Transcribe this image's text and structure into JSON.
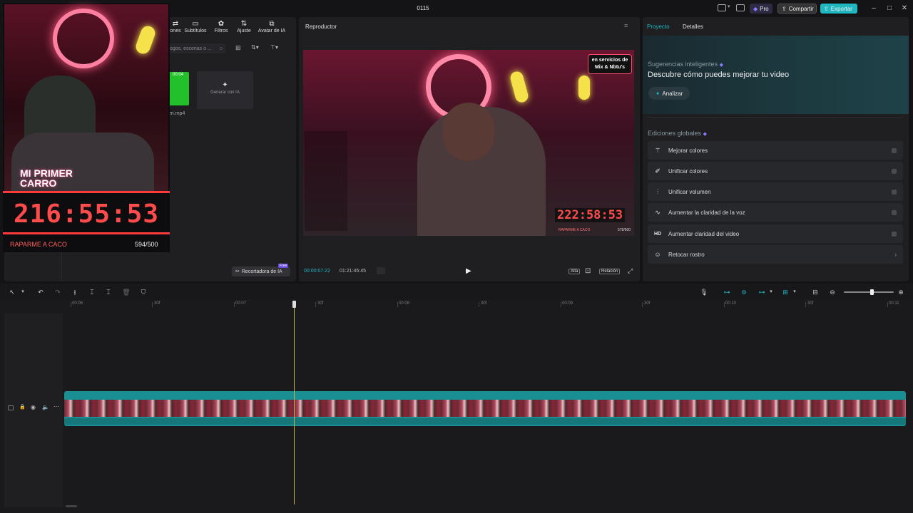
{
  "titlebar": {
    "title": "0115",
    "pro_label": "Pro",
    "share_label": "Compartir",
    "export_label": "Exportar"
  },
  "overlay": {
    "neon_sign_text": "MI PRIMER CARRO",
    "timer": "216:55:53",
    "goal_label": "RAPARME A CACO",
    "goal_count": "594/500"
  },
  "media_panel": {
    "tabs": [
      {
        "label": "ones",
        "icon": "transitions-icon"
      },
      {
        "label": "Subtítulos",
        "icon": "subtitles-icon"
      },
      {
        "label": "Filtros",
        "icon": "filters-icon"
      },
      {
        "label": "Ajuste",
        "icon": "adjust-icon"
      },
      {
        "label": "Avatar de IA",
        "icon": "ai-avatar-icon"
      }
    ],
    "search_placeholder": "ogos, escenas o ...",
    "clip_duration": "00:04",
    "clip_name": "en.mp4",
    "generate_label": "Generar con IA",
    "ai_cutter_label": "Recortadora de IA",
    "free_badge": "Free"
  },
  "player": {
    "title": "Reproductor",
    "current_time": "00:00:07:22",
    "total_time": "01:21:45:45",
    "quality_label": "Alta",
    "ratio_label": "Relación",
    "video": {
      "promo_line1": "en servicios de",
      "promo_line2": "Mix & Nbtu's",
      "timer": "222:58:53",
      "goal_label": "RAPARME A CACO",
      "goal_count": "578/500"
    }
  },
  "right_panel": {
    "tabs": [
      "Proyecto",
      "Detalles"
    ],
    "suggestions_label": "Sugerencias inteligentes",
    "suggestions_headline": "Descubre cómo puedes mejorar tu video",
    "analyze_label": "Analizar",
    "global_edits_label": "Ediciones globales",
    "items": [
      {
        "label": "Mejorar colores",
        "icon": "magic-wand-icon"
      },
      {
        "label": "Unificar colores",
        "icon": "color-match-icon"
      },
      {
        "label": "Unificar volumen",
        "icon": "volume-bars-icon"
      },
      {
        "label": "Aumentar la claridad de la voz",
        "icon": "voice-wave-icon"
      },
      {
        "label": "Aumentar claridad del video",
        "icon": "hd-icon"
      },
      {
        "label": "Retocar rostro",
        "icon": "face-retouch-icon"
      }
    ]
  },
  "timeline": {
    "ruler": [
      "00:06",
      "30f",
      "00:07",
      "30f",
      "00:08",
      "30f",
      "00:09",
      "30f",
      "00:10",
      "30f",
      "00:11"
    ]
  },
  "colors": {
    "accent": "#1fb6c0",
    "pro": "#5b4fd6",
    "track": "#1a8f93",
    "playhead": "#c9b44a",
    "timer_red": "#ff4b4b"
  }
}
